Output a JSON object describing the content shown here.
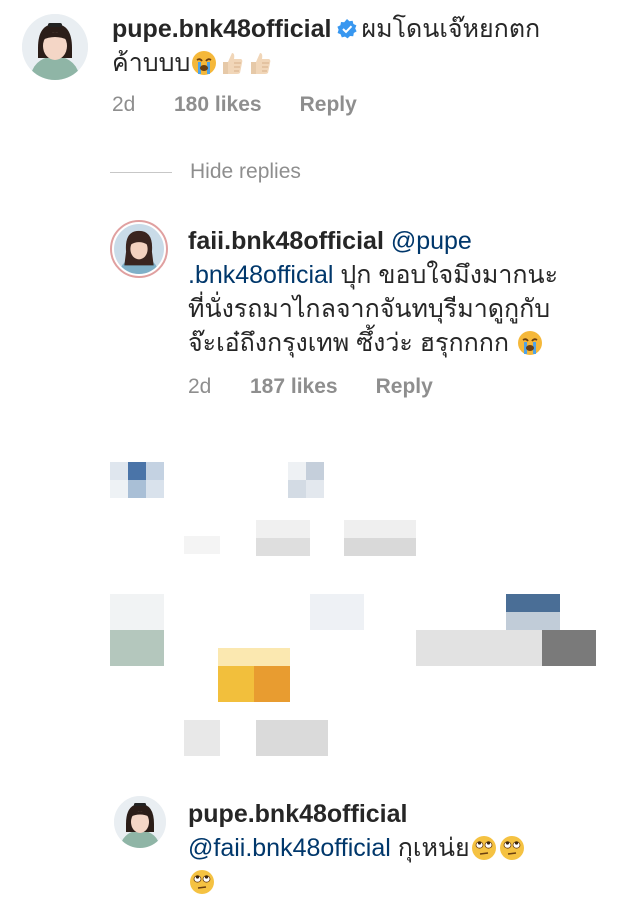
{
  "comments": [
    {
      "username": "pupe.bnk48official",
      "verified": true,
      "text_line1": "ผมโดนเจ๊หยกตก",
      "text_line2": "ค้าบบบ",
      "emojis": [
        "crying-face",
        "thumbs-up",
        "thumbs-up"
      ],
      "time": "2d",
      "likes": "180 likes",
      "reply": "Reply"
    }
  ],
  "hide_replies": "Hide replies",
  "replies": [
    {
      "username": "faii.bnk48official",
      "mention_a": "@pupe",
      "mention_b": ".bnk48official",
      "line1_rest": " ปุก ขอบใจมึงมากนะ",
      "line2": "ที่นั่งรถมาไกลจากจันทบุรีมาดูกูกับ",
      "line3": "จ๊ะเอ๋ถึงกรุงเทพ ซึ้งว่ะ ฮรุกกกก",
      "emoji": "crying-face",
      "time": "2d",
      "likes": "187 likes",
      "reply": "Reply"
    },
    {
      "username": "pupe.bnk48official",
      "mention": "@faii.bnk48official",
      "text": " กุเหน่ย",
      "emojis": [
        "eye-roll",
        "eye-roll",
        "eye-roll"
      ]
    }
  ],
  "colors": {
    "text": "#262626",
    "muted": "#8e8e8e",
    "mention": "#00376b",
    "verified": "#3897f0"
  }
}
